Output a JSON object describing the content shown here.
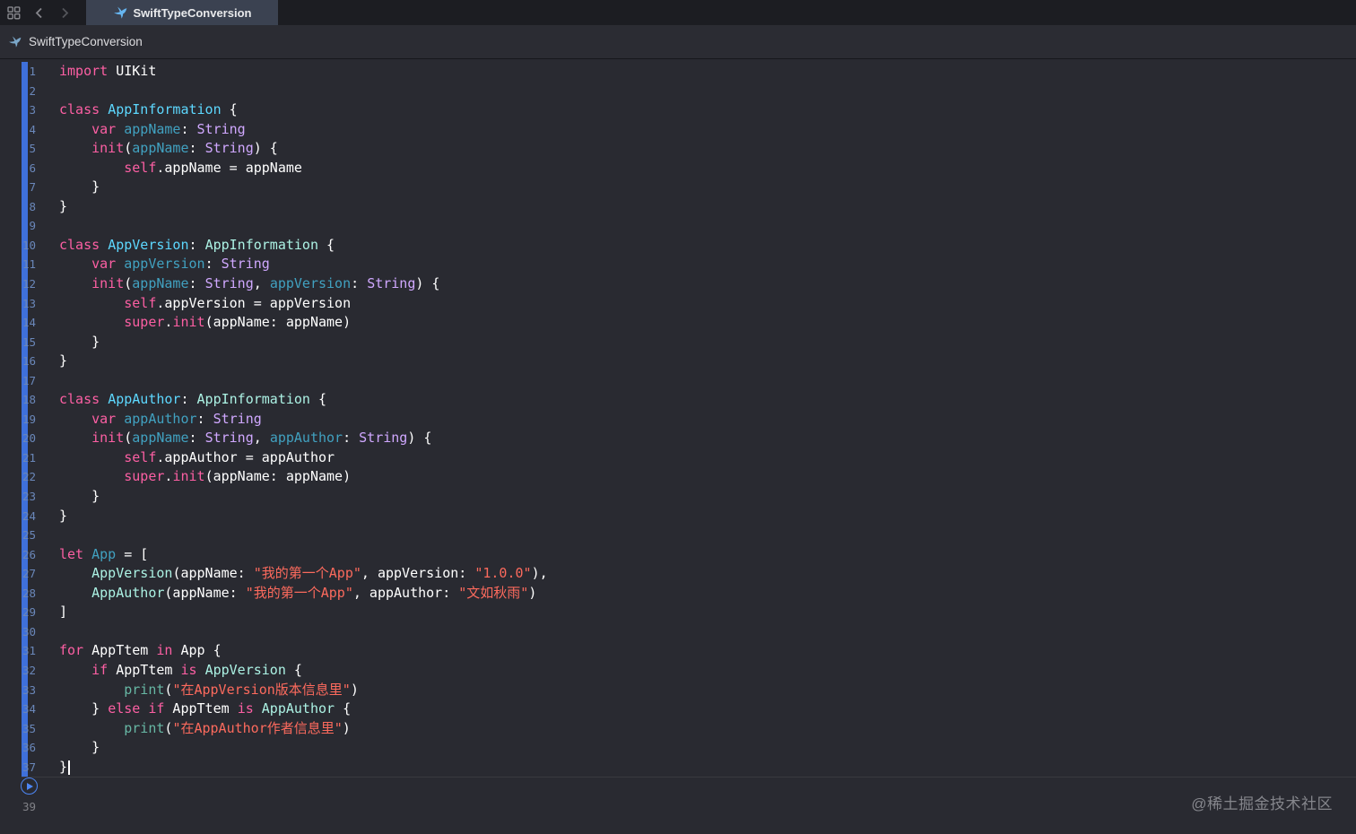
{
  "tab_bar": {
    "tab_label": "SwiftTypeConversion"
  },
  "jump_bar": {
    "title": "SwiftTypeConversion"
  },
  "icons": {
    "tab_overview": "grid-icon",
    "back": "chevron-left-icon",
    "forward": "chevron-right-icon",
    "playground_file": "swift-bird-icon",
    "run": "play-icon"
  },
  "watermark": "@稀土掘金技术社区",
  "editor": {
    "trailing_line_number": "39",
    "accent_strip_color": "#3f70da",
    "colors": {
      "kw": "#fc5fa3",
      "plain": "#ffffff",
      "typeDecl": "#5dd8ff",
      "decl": "#41a1c0",
      "projClass": "#acf2e4",
      "otherClass": "#d0a8ff",
      "string": "#fc6a5d",
      "func": "#67b7a4"
    },
    "lines": [
      {
        "n": 1,
        "tokens": [
          [
            "import",
            "kw"
          ],
          [
            " UIKit",
            "plain"
          ]
        ]
      },
      {
        "n": 2,
        "tokens": []
      },
      {
        "n": 3,
        "tokens": [
          [
            "class",
            "kw"
          ],
          [
            " ",
            "plain"
          ],
          [
            "AppInformation",
            "typeDecl"
          ],
          [
            " {",
            "plain"
          ]
        ]
      },
      {
        "n": 4,
        "tokens": [
          [
            "    ",
            "plain"
          ],
          [
            "var",
            "kw"
          ],
          [
            " ",
            "plain"
          ],
          [
            "appName",
            "decl"
          ],
          [
            ": ",
            "plain"
          ],
          [
            "String",
            "otherClass"
          ]
        ]
      },
      {
        "n": 5,
        "tokens": [
          [
            "    ",
            "plain"
          ],
          [
            "init",
            "kw"
          ],
          [
            "(",
            "plain"
          ],
          [
            "appName",
            "decl"
          ],
          [
            ": ",
            "plain"
          ],
          [
            "String",
            "otherClass"
          ],
          [
            ") {",
            "plain"
          ]
        ]
      },
      {
        "n": 6,
        "tokens": [
          [
            "        ",
            "plain"
          ],
          [
            "self",
            "kw"
          ],
          [
            ".appName = appName",
            "plain"
          ]
        ]
      },
      {
        "n": 7,
        "tokens": [
          [
            "    }",
            "plain"
          ]
        ]
      },
      {
        "n": 8,
        "tokens": [
          [
            "}",
            "plain"
          ]
        ]
      },
      {
        "n": 9,
        "tokens": []
      },
      {
        "n": 10,
        "tokens": [
          [
            "class",
            "kw"
          ],
          [
            " ",
            "plain"
          ],
          [
            "AppVersion",
            "typeDecl"
          ],
          [
            ": ",
            "plain"
          ],
          [
            "AppInformation",
            "projClass"
          ],
          [
            " {",
            "plain"
          ]
        ]
      },
      {
        "n": 11,
        "tokens": [
          [
            "    ",
            "plain"
          ],
          [
            "var",
            "kw"
          ],
          [
            " ",
            "plain"
          ],
          [
            "appVersion",
            "decl"
          ],
          [
            ": ",
            "plain"
          ],
          [
            "String",
            "otherClass"
          ]
        ]
      },
      {
        "n": 12,
        "tokens": [
          [
            "    ",
            "plain"
          ],
          [
            "init",
            "kw"
          ],
          [
            "(",
            "plain"
          ],
          [
            "appName",
            "decl"
          ],
          [
            ": ",
            "plain"
          ],
          [
            "String",
            "otherClass"
          ],
          [
            ", ",
            "plain"
          ],
          [
            "appVersion",
            "decl"
          ],
          [
            ": ",
            "plain"
          ],
          [
            "String",
            "otherClass"
          ],
          [
            ") {",
            "plain"
          ]
        ]
      },
      {
        "n": 13,
        "tokens": [
          [
            "        ",
            "plain"
          ],
          [
            "self",
            "kw"
          ],
          [
            ".appVersion = appVersion",
            "plain"
          ]
        ]
      },
      {
        "n": 14,
        "tokens": [
          [
            "        ",
            "plain"
          ],
          [
            "super",
            "kw"
          ],
          [
            ".",
            "plain"
          ],
          [
            "init",
            "kw"
          ],
          [
            "(appName: appName)",
            "plain"
          ]
        ]
      },
      {
        "n": 15,
        "tokens": [
          [
            "    }",
            "plain"
          ]
        ]
      },
      {
        "n": 16,
        "tokens": [
          [
            "}",
            "plain"
          ]
        ]
      },
      {
        "n": 17,
        "tokens": []
      },
      {
        "n": 18,
        "tokens": [
          [
            "class",
            "kw"
          ],
          [
            " ",
            "plain"
          ],
          [
            "AppAuthor",
            "typeDecl"
          ],
          [
            ": ",
            "plain"
          ],
          [
            "AppInformation",
            "projClass"
          ],
          [
            " {",
            "plain"
          ]
        ]
      },
      {
        "n": 19,
        "tokens": [
          [
            "    ",
            "plain"
          ],
          [
            "var",
            "kw"
          ],
          [
            " ",
            "plain"
          ],
          [
            "appAuthor",
            "decl"
          ],
          [
            ": ",
            "plain"
          ],
          [
            "String",
            "otherClass"
          ]
        ]
      },
      {
        "n": 20,
        "tokens": [
          [
            "    ",
            "plain"
          ],
          [
            "init",
            "kw"
          ],
          [
            "(",
            "plain"
          ],
          [
            "appName",
            "decl"
          ],
          [
            ": ",
            "plain"
          ],
          [
            "String",
            "otherClass"
          ],
          [
            ", ",
            "plain"
          ],
          [
            "appAuthor",
            "decl"
          ],
          [
            ": ",
            "plain"
          ],
          [
            "String",
            "otherClass"
          ],
          [
            ") {",
            "plain"
          ]
        ]
      },
      {
        "n": 21,
        "tokens": [
          [
            "        ",
            "plain"
          ],
          [
            "self",
            "kw"
          ],
          [
            ".appAuthor = appAuthor",
            "plain"
          ]
        ]
      },
      {
        "n": 22,
        "tokens": [
          [
            "        ",
            "plain"
          ],
          [
            "super",
            "kw"
          ],
          [
            ".",
            "plain"
          ],
          [
            "init",
            "kw"
          ],
          [
            "(appName: appName)",
            "plain"
          ]
        ]
      },
      {
        "n": 23,
        "tokens": [
          [
            "    }",
            "plain"
          ]
        ]
      },
      {
        "n": 24,
        "tokens": [
          [
            "}",
            "plain"
          ]
        ]
      },
      {
        "n": 25,
        "tokens": []
      },
      {
        "n": 26,
        "tokens": [
          [
            "let",
            "kw"
          ],
          [
            " ",
            "plain"
          ],
          [
            "App",
            "decl"
          ],
          [
            " = [",
            "plain"
          ]
        ]
      },
      {
        "n": 27,
        "tokens": [
          [
            "    ",
            "plain"
          ],
          [
            "AppVersion",
            "projClass"
          ],
          [
            "(appName: ",
            "plain"
          ],
          [
            "\"我的第一个App\"",
            "string"
          ],
          [
            ", appVersion: ",
            "plain"
          ],
          [
            "\"1.0.0\"",
            "string"
          ],
          [
            "),",
            "plain"
          ]
        ]
      },
      {
        "n": 28,
        "tokens": [
          [
            "    ",
            "plain"
          ],
          [
            "AppAuthor",
            "projClass"
          ],
          [
            "(appName: ",
            "plain"
          ],
          [
            "\"我的第一个App\"",
            "string"
          ],
          [
            ", appAuthor: ",
            "plain"
          ],
          [
            "\"文如秋雨\"",
            "string"
          ],
          [
            ")",
            "plain"
          ]
        ]
      },
      {
        "n": 29,
        "tokens": [
          [
            "]",
            "plain"
          ]
        ]
      },
      {
        "n": 30,
        "tokens": []
      },
      {
        "n": 31,
        "tokens": [
          [
            "for",
            "kw"
          ],
          [
            " AppTtem ",
            "plain"
          ],
          [
            "in",
            "kw"
          ],
          [
            " App {",
            "plain"
          ]
        ]
      },
      {
        "n": 32,
        "tokens": [
          [
            "    ",
            "plain"
          ],
          [
            "if",
            "kw"
          ],
          [
            " AppTtem ",
            "plain"
          ],
          [
            "is",
            "kw"
          ],
          [
            " ",
            "plain"
          ],
          [
            "AppVersion",
            "projClass"
          ],
          [
            " {",
            "plain"
          ]
        ]
      },
      {
        "n": 33,
        "tokens": [
          [
            "        ",
            "plain"
          ],
          [
            "print",
            "func"
          ],
          [
            "(",
            "plain"
          ],
          [
            "\"在AppVersion版本信息里\"",
            "string"
          ],
          [
            ")",
            "plain"
          ]
        ]
      },
      {
        "n": 34,
        "tokens": [
          [
            "    } ",
            "plain"
          ],
          [
            "else",
            "kw"
          ],
          [
            " ",
            "plain"
          ],
          [
            "if",
            "kw"
          ],
          [
            " AppTtem ",
            "plain"
          ],
          [
            "is",
            "kw"
          ],
          [
            " ",
            "plain"
          ],
          [
            "AppAuthor",
            "projClass"
          ],
          [
            " {",
            "plain"
          ]
        ]
      },
      {
        "n": 35,
        "tokens": [
          [
            "        ",
            "plain"
          ],
          [
            "print",
            "func"
          ],
          [
            "(",
            "plain"
          ],
          [
            "\"在AppAuthor作者信息里\"",
            "string"
          ],
          [
            ")",
            "plain"
          ]
        ]
      },
      {
        "n": 36,
        "tokens": [
          [
            "    }",
            "plain"
          ]
        ]
      },
      {
        "n": 37,
        "tokens": [
          [
            "}",
            "plain"
          ]
        ],
        "caret": true
      }
    ]
  }
}
